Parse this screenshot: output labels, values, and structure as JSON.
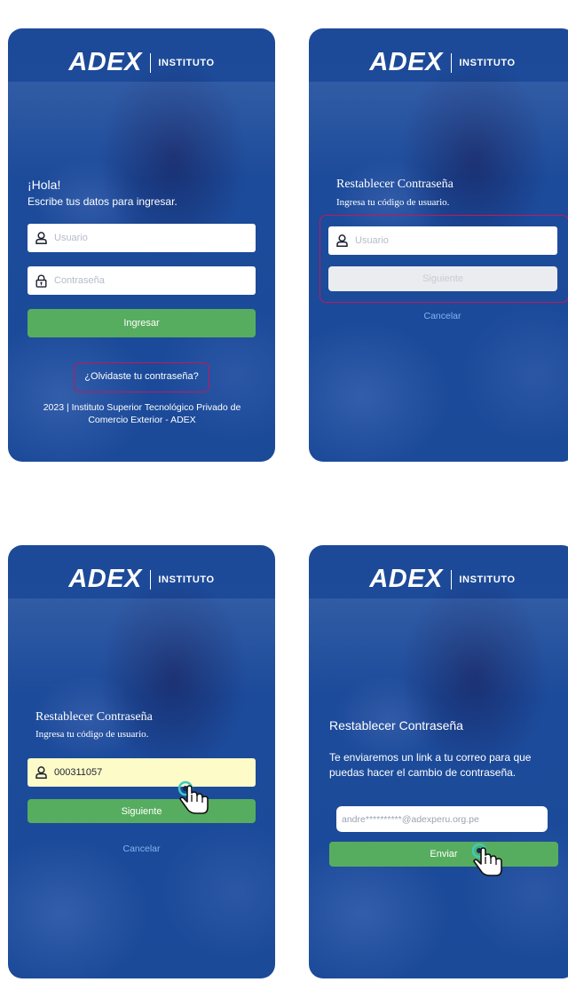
{
  "brand": {
    "name": "ADEX",
    "tagline": "INSTITUTO"
  },
  "login": {
    "greeting": "¡Hola!",
    "instruction": "Escribe tus datos para ingresar.",
    "user_placeholder": "Usuario",
    "password_placeholder": "Contraseña",
    "submit_label": "Ingresar",
    "forgot_label": "¿Olvidaste tu contraseña?",
    "footer": "2023 | Instituto Superior Tecnológico Privado de Comercio Exterior - ADEX"
  },
  "reset_step1": {
    "title": "Restablecer Contraseña",
    "instruction": "Ingresa tu código de usuario.",
    "user_placeholder": "Usuario",
    "next_label": "Siguiente",
    "cancel_label": "Cancelar"
  },
  "reset_step2": {
    "title": "Restablecer Contraseña",
    "instruction": "Ingresa tu código de usuario.",
    "user_value": "000311057",
    "next_label": "Siguiente",
    "cancel_label": "Cancelar"
  },
  "reset_step3": {
    "title": "Restablecer Contraseña",
    "message": "Te enviaremos un link a tu correo para que puedas hacer el cambio de contraseña.",
    "email_masked": "andre**********@adexperu.org.pe",
    "send_label": "Enviar"
  },
  "colors": {
    "background_blue": "#1c4b9b",
    "button_green": "#57ad5f",
    "highlight": "#c2185b",
    "link_blue": "#7fb5f0",
    "autofill_yellow": "#fdfbc7"
  },
  "icons": [
    "user-icon",
    "lock-icon",
    "pointer-hand-icon"
  ]
}
